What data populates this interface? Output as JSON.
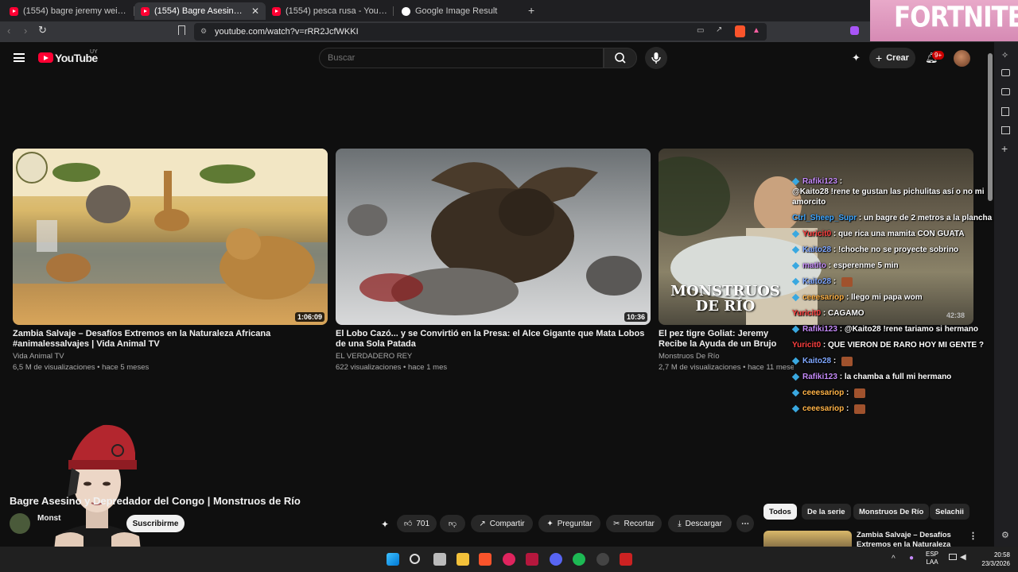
{
  "browser": {
    "tabs": [
      {
        "label": "(1554) bagre jeremy weid - YouTube",
        "active": false
      },
      {
        "label": "(1554) Bagre Asesino y Depredad",
        "active": true
      },
      {
        "label": "(1554) pesca rusa - YouTube",
        "active": false
      },
      {
        "label": "Google Image Result",
        "active": false
      }
    ],
    "url": "youtube.com/watch?v=rRR2JcfWKKI"
  },
  "overlay_banner": {
    "text": "FORTNITE"
  },
  "youtube": {
    "logo_text": "YouTube",
    "region": "UY",
    "search_placeholder": "Buscar",
    "create_label": "Crear",
    "notification_count": "9+"
  },
  "videos": [
    {
      "title": "Zambia Salvaje – Desafíos Extremos en la Naturaleza Africana #animalessalvajes | Vida Animal TV",
      "channel": "Vida Animal TV",
      "meta": "6,5 M de visualizaciones • hace 5 meses",
      "duration": "1:06:09"
    },
    {
      "title": "El Lobo Cazó... y se Convirtió en la Presa: el Alce Gigante que Mata Lobos de una Sola Patada",
      "channel": "EL VERDADERO REY",
      "meta": "622 visualizaciones • hace 1 mes",
      "duration": "10:36"
    },
    {
      "title": "El pez tigre Goliat: Jeremy Recibe la Ayuda de un Brujo Local",
      "channel": "Monstruos De Río",
      "meta": "2,7 M de visualizaciones • hace 11 meses",
      "duration": "42:38",
      "thumb_text": "MONSTRUOS DE RÍO"
    }
  ],
  "chat": [
    {
      "user": "Rafiki123",
      "text": "@Kaito28 !rene te gustan las pichulitas así o no mi amorcito",
      "color": "#c58af9",
      "badge": true
    },
    {
      "user": "Ctrl_Sheep_Supr",
      "text": "un bagre de 2 metros a la plancha",
      "color": "#3ea6ff",
      "badge": false
    },
    {
      "user": "Yuricit0",
      "text": "que rica una mamita CON GUATA",
      "color": "#ff4040",
      "badge": true
    },
    {
      "user": "Kaito28",
      "text": "!choche no se proyecte sobrino",
      "color": "#7fa7ff",
      "badge": true
    },
    {
      "user": "matito",
      "text": "esperenme 5 min",
      "color": "#c58af9",
      "badge": true
    },
    {
      "user": "Kaito28",
      "text": "",
      "color": "#7fa7ff",
      "badge": true,
      "emote": true
    },
    {
      "user": "ceeesariop",
      "text": "llego mi papa wom",
      "color": "#ffb347",
      "badge": true
    },
    {
      "user": "Yuricit0",
      "text": "CAGAMO",
      "color": "#ff4040",
      "badge": false
    },
    {
      "user": "Rafiki123",
      "text": "@Kaito28 !rene tariamo si hermano",
      "color": "#c58af9",
      "badge": true
    },
    {
      "user": "Yuricit0",
      "text": "QUE VIERON DE RARO HOY MI GENTE ?",
      "color": "#ff4040",
      "badge": false
    },
    {
      "user": "Kaito28",
      "text": "",
      "color": "#7fa7ff",
      "badge": true,
      "emote": true
    },
    {
      "user": "Rafiki123",
      "text": "la chamba a full mi hermano",
      "color": "#c58af9",
      "badge": true
    },
    {
      "user": "ceeesariop",
      "text": "",
      "color": "#ffb347",
      "badge": true,
      "emote": true
    },
    {
      "user": "ceeesariop",
      "text": "",
      "color": "#ffb347",
      "badge": true,
      "emote": true
    }
  ],
  "watch": {
    "title": "Bagre Asesino y Depredador del Congo | Monstruos de Río",
    "channel_short": "Monst",
    "subscribe_label": "Suscribirme",
    "likes": "701",
    "share_label": "Compartir",
    "ask_label": "Preguntar",
    "clip_label": "Recortar",
    "download_label": "Descargar"
  },
  "chips": [
    "Todos",
    "De la serie",
    "Monstruos De Río",
    "Selachii"
  ],
  "related": {
    "title": "Zambia Salvaje – Desafíos Extremos en la Naturaleza"
  },
  "taskbar": {
    "lang": "ESP",
    "lang2": "LAA",
    "time": "20:58",
    "date": "23/3/2026"
  }
}
